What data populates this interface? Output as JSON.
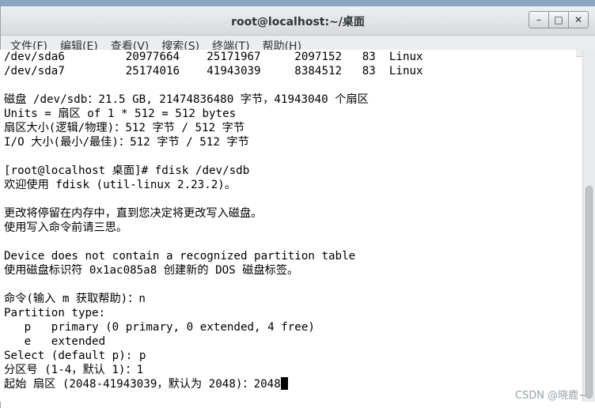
{
  "window": {
    "title": "root@localhost:~/桌面",
    "buttons": {
      "minimize": "–",
      "maximize": "□",
      "close": "✕"
    }
  },
  "menubar": [
    "文件(F)",
    "编辑(E)",
    "查看(V)",
    "搜索(S)",
    "终端(T)",
    "帮助(H)"
  ],
  "terminal": {
    "lines": [
      "/dev/sda6         20977664    25171967     2097152   83  Linux",
      "/dev/sda7         25174016    41943039     8384512   83  Linux",
      "",
      "磁盘 /dev/sdb：21.5 GB, 21474836480 字节，41943040 个扇区",
      "Units = 扇区 of 1 * 512 = 512 bytes",
      "扇区大小(逻辑/物理)：512 字节 / 512 字节",
      "I/O 大小(最小/最佳)：512 字节 / 512 字节",
      "",
      "[root@localhost 桌面]# fdisk /dev/sdb",
      "欢迎使用 fdisk (util-linux 2.23.2)。",
      "",
      "更改将停留在内存中，直到您决定将更改写入磁盘。",
      "使用写入命令前请三思。",
      "",
      "Device does not contain a recognized partition table",
      "使用磁盘标识符 0x1ac085a8 创建新的 DOS 磁盘标签。",
      "",
      "命令(输入 m 获取帮助)：n",
      "Partition type:",
      "   p   primary (0 primary, 0 extended, 4 free)",
      "   e   extended",
      "Select (default p): p",
      "分区号 (1-4，默认 1)：1",
      "起始 扇区 (2048-41943039，默认为 2048)：2048"
    ]
  },
  "watermark": "CSDN @晓鹿~"
}
